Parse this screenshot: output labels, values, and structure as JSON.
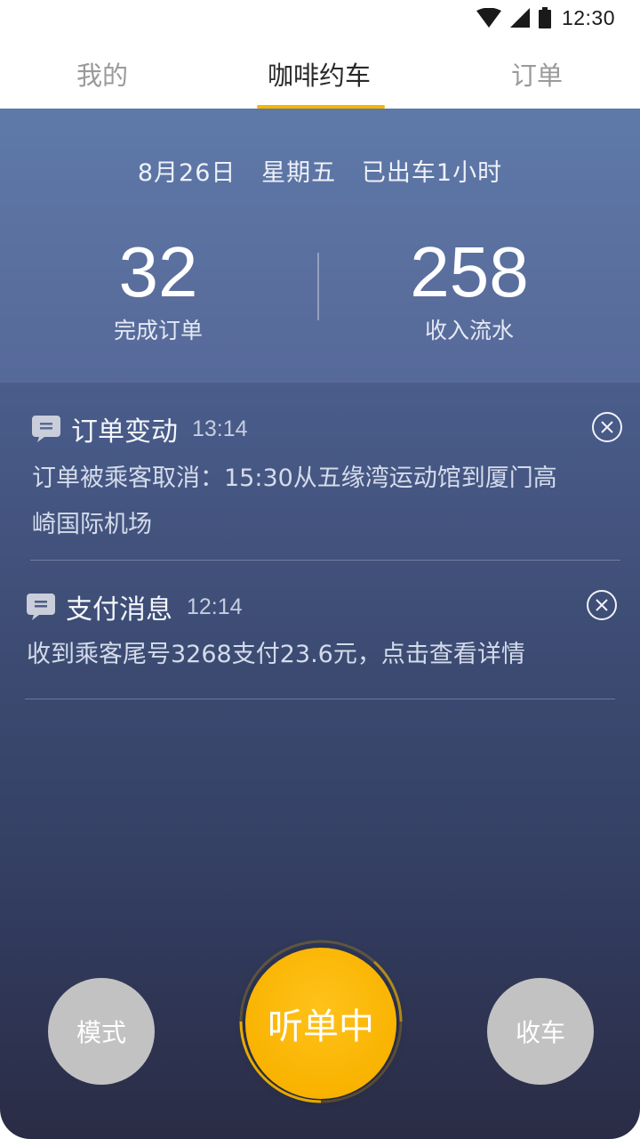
{
  "status_bar": {
    "time": "12:30"
  },
  "tabs": [
    {
      "label": "我的"
    },
    {
      "label": "咖啡约车"
    },
    {
      "label": "订单"
    }
  ],
  "summary": {
    "date": "8月26日",
    "weekday": "星期五",
    "duration": "已出车1小时",
    "orders": {
      "value": "32",
      "label": "完成订单"
    },
    "income": {
      "value": "258",
      "label": "收入流水"
    }
  },
  "notices": [
    {
      "icon": "chat-icon",
      "title": "订单变动",
      "time": "13:14",
      "body_line1": "订单被乘客取消：15:30从五缘湾运动馆到厦门高",
      "body_line2": "崎国际机场"
    },
    {
      "icon": "chat-icon",
      "title": "支付消息",
      "time": "12:14",
      "body_line1": "收到乘客尾号3268支付23.6元，点击查看详情"
    }
  ],
  "controls": {
    "mode_label": "模式",
    "listen_label": "听单中",
    "finish_label": "收车"
  },
  "colors": {
    "accent": "#f5b600",
    "header_bg": "#5e79a9",
    "side_button": "#c2c2c2"
  }
}
